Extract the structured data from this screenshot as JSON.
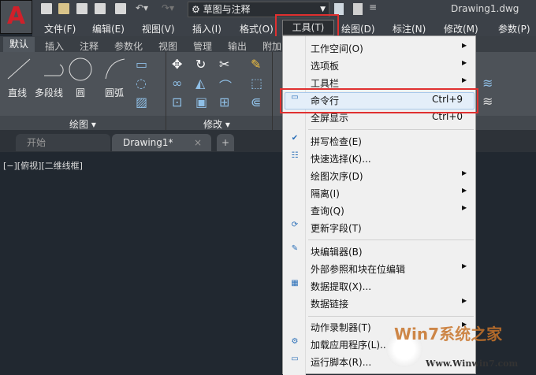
{
  "titlebar": {
    "workspace": "草图与注释",
    "document": "Drawing1.dwg"
  },
  "menubar": [
    "文件(F)",
    "编辑(E)",
    "视图(V)",
    "插入(I)",
    "格式(O)",
    "工具(T)",
    "绘图(D)",
    "标注(N)",
    "修改(M)",
    "参数(P)"
  ],
  "ribbon_tabs": [
    "默认",
    "插入",
    "注释",
    "参数化",
    "视图",
    "管理",
    "输出",
    "附加"
  ],
  "draw_tools": [
    "直线",
    "多段线",
    "圆",
    "圆弧"
  ],
  "panel_titles": {
    "draw": "绘图 ▾",
    "modify": "修改 ▾"
  },
  "file_tabs": {
    "start": "开始",
    "drawing": "Drawing1*",
    "close": "×",
    "new": "+"
  },
  "viewport_label": "[−][俯视][二维线框]",
  "tools_menu": {
    "items": [
      {
        "label": "工作空间(O)",
        "submenu": true
      },
      {
        "label": "选项板",
        "submenu": true
      },
      {
        "label": "工具栏",
        "submenu": true
      },
      {
        "label": "命令行",
        "shortcut": "Ctrl+9",
        "icon": "command-line-icon",
        "highlighted": true
      },
      {
        "label": "全屏显示",
        "shortcut": "Ctrl+0"
      },
      {
        "label": "拼写检查(E)",
        "icon": "spell-check-icon"
      },
      {
        "label": "快速选择(K)...",
        "icon": "quick-select-icon"
      },
      {
        "label": "绘图次序(D)",
        "submenu": true
      },
      {
        "label": "隔离(I)",
        "submenu": true
      },
      {
        "label": "查询(Q)",
        "submenu": true
      },
      {
        "label": "更新字段(T)",
        "icon": "update-field-icon"
      },
      {
        "label": "块编辑器(B)",
        "icon": "block-editor-icon"
      },
      {
        "label": "外部参照和块在位编辑",
        "submenu": true
      },
      {
        "label": "数据提取(X)...",
        "icon": "data-extraction-icon"
      },
      {
        "label": "数据链接",
        "submenu": true
      },
      {
        "label": "动作录制器(T)",
        "submenu": true
      },
      {
        "label": "加载应用程序(L)...",
        "icon": "load-application-icon"
      },
      {
        "label": "运行脚本(R)...",
        "icon": "run-script-icon"
      }
    ]
  },
  "watermark": {
    "brand": "Win7系统之家",
    "url": "Www.Winwin7.com"
  },
  "colors": {
    "highlight_box": "#e03030",
    "menu_bg": "#f0f0f0",
    "canvas": "#212830"
  }
}
